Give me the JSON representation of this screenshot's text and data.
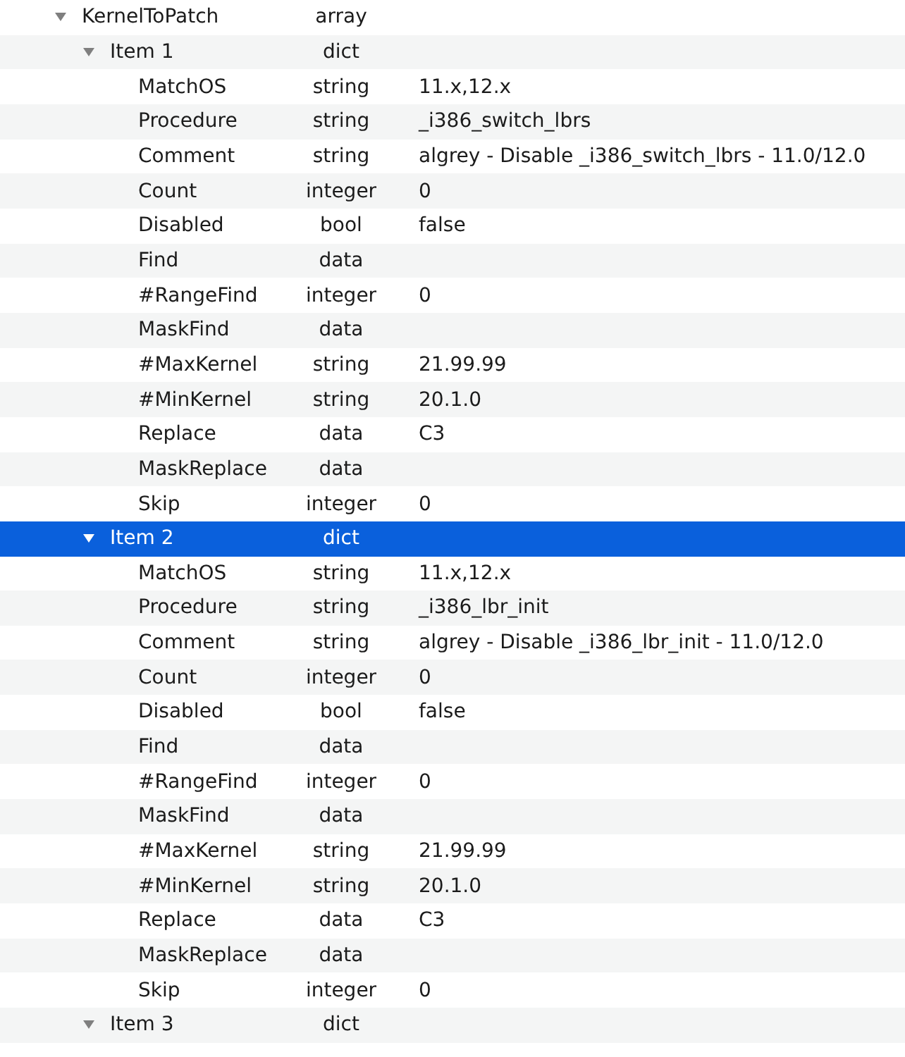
{
  "tree": [
    {
      "key": "KernelToPatch",
      "type": "array",
      "expanded": true,
      "selected": false,
      "children": [
        {
          "key": "Item 1",
          "type": "dict",
          "expanded": true,
          "selected": false,
          "children": [
            {
              "key": "MatchOS",
              "type": "string",
              "value": "11.x,12.x",
              "selected": false
            },
            {
              "key": "Procedure",
              "type": "string",
              "value": "_i386_switch_lbrs",
              "selected": false
            },
            {
              "key": "Comment",
              "type": "string",
              "value": "algrey - Disable _i386_switch_lbrs - 11.0/12.0",
              "selected": false
            },
            {
              "key": "Count",
              "type": "integer",
              "value": "0",
              "selected": false
            },
            {
              "key": "Disabled",
              "type": "bool",
              "value": "false",
              "selected": false
            },
            {
              "key": "Find",
              "type": "data",
              "selected": false
            },
            {
              "key": "#RangeFind",
              "type": "integer",
              "value": "0",
              "selected": false
            },
            {
              "key": "MaskFind",
              "type": "data",
              "selected": false
            },
            {
              "key": "#MaxKernel",
              "type": "string",
              "value": "21.99.99",
              "selected": false
            },
            {
              "key": "#MinKernel",
              "type": "string",
              "value": "20.1.0",
              "selected": false
            },
            {
              "key": "Replace",
              "type": "data",
              "value": "C3",
              "selected": false
            },
            {
              "key": "MaskReplace",
              "type": "data",
              "selected": false
            },
            {
              "key": "Skip",
              "type": "integer",
              "value": "0",
              "selected": false
            }
          ]
        },
        {
          "key": "Item 2",
          "type": "dict",
          "expanded": true,
          "selected": true,
          "children": [
            {
              "key": "MatchOS",
              "type": "string",
              "value": "11.x,12.x",
              "selected": false
            },
            {
              "key": "Procedure",
              "type": "string",
              "value": "_i386_lbr_init",
              "selected": false
            },
            {
              "key": "Comment",
              "type": "string",
              "value": "algrey - Disable _i386_lbr_init - 11.0/12.0",
              "selected": false
            },
            {
              "key": "Count",
              "type": "integer",
              "value": "0",
              "selected": false
            },
            {
              "key": "Disabled",
              "type": "bool",
              "value": "false",
              "selected": false
            },
            {
              "key": "Find",
              "type": "data",
              "selected": false
            },
            {
              "key": "#RangeFind",
              "type": "integer",
              "value": "0",
              "selected": false
            },
            {
              "key": "MaskFind",
              "type": "data",
              "selected": false
            },
            {
              "key": "#MaxKernel",
              "type": "string",
              "value": "21.99.99",
              "selected": false
            },
            {
              "key": "#MinKernel",
              "type": "string",
              "value": "20.1.0",
              "selected": false
            },
            {
              "key": "Replace",
              "type": "data",
              "value": "C3",
              "selected": false
            },
            {
              "key": "MaskReplace",
              "type": "data",
              "selected": false
            },
            {
              "key": "Skip",
              "type": "integer",
              "value": "0",
              "selected": false
            }
          ]
        },
        {
          "key": "Item 3",
          "type": "dict",
          "expanded": true,
          "selected": false
        }
      ]
    }
  ]
}
